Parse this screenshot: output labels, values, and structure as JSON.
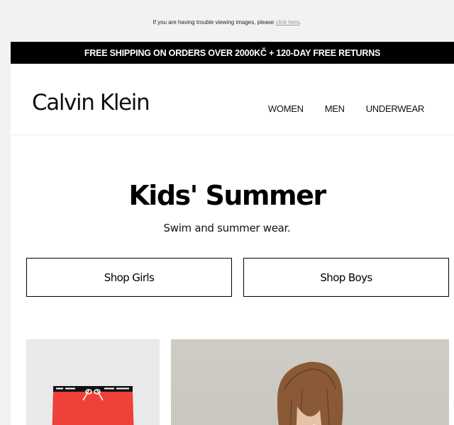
{
  "preheader": {
    "text": "If you are having trouble viewing images, please",
    "link": "click here",
    "end": "."
  },
  "banner": {
    "shipping": "FREE SHIPPING ON ORDERS OVER 2000KČ + 120-DAY FREE RETURNS"
  },
  "header": {
    "logo": "Calvin Klein",
    "nav": [
      "WOMEN",
      "MEN",
      "UNDERWEAR"
    ]
  },
  "hero": {
    "title": "Kids' Summer",
    "subtitle": "Swim and summer wear."
  },
  "buttons": {
    "girls": "Shop Girls",
    "boys": "Shop Boys"
  },
  "colors": {
    "banner_bg": "#000000",
    "shorts": "#f0403a",
    "page_bg": "#f3f2f0"
  }
}
